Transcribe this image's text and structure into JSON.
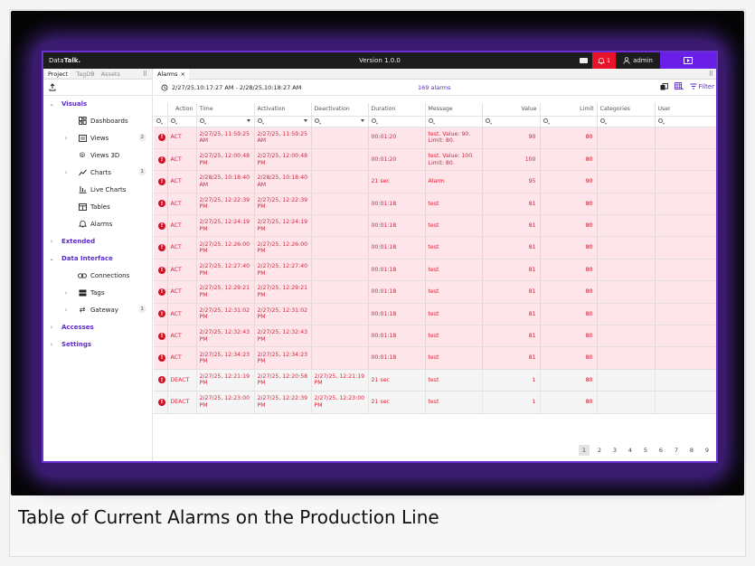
{
  "app": {
    "logo_prefix": "Data",
    "logo_bold": "Talk.",
    "version": "Version 1.0.0",
    "alarm_count": "1",
    "user": "admin"
  },
  "colors": {
    "accent": "#5b2ad0",
    "alarm_red": "#e8132a",
    "active_row": "#fde5ea",
    "titlebar": "#1d1d1d"
  },
  "left_tabs": [
    "Project",
    "TagDB",
    "Assets"
  ],
  "nav": {
    "visuals": "Visuals",
    "dashboards": "Dashboards",
    "views": "Views",
    "views_count": "2",
    "views3d": "Views 3D",
    "charts": "Charts",
    "charts_count": "1",
    "livecharts": "Live Charts",
    "tables": "Tables",
    "alarms": "Alarms",
    "extended": "Extended",
    "datainterface": "Data Interface",
    "connections": "Connections",
    "tags": "Tags",
    "gateway": "Gateway",
    "gateway_count": "1",
    "accesses": "Accesses",
    "settings": "Settings"
  },
  "main_tab": {
    "label": "Alarms",
    "close": "×"
  },
  "toolbar": {
    "range": "2/27/25,10:17:27 AM - 2/28/25,10:18:27 AM",
    "count": "169 alarms",
    "filter": "Filter"
  },
  "columns": [
    "Action",
    "Time",
    "Activation",
    "Deactivation",
    "Duration",
    "Message",
    "Value",
    "Limit",
    "Categories",
    "User"
  ],
  "rows": [
    {
      "action": "ACT",
      "time": "2/27/25, 11:59:25 AM",
      "activation": "2/27/25, 11:59:25 AM",
      "deactivation": "",
      "duration": "00:01:20",
      "message": "test. Value: 90. Limit: 80.",
      "value": "90",
      "limit": "80"
    },
    {
      "action": "ACT",
      "time": "2/27/25, 12:00:48 PM",
      "activation": "2/27/25, 12:00:48 PM",
      "deactivation": "",
      "duration": "00:01:20",
      "message": "test. Value: 100. Limit: 80.",
      "value": "100",
      "limit": "80"
    },
    {
      "action": "ACT",
      "time": "2/28/25, 10:18:40 AM",
      "activation": "2/28/25, 10:18:40 AM",
      "deactivation": "",
      "duration": "21 sec",
      "message": "Alarm",
      "value": "95",
      "limit": "90"
    },
    {
      "action": "ACT",
      "time": "2/27/25, 12:22:39 PM",
      "activation": "2/27/25, 12:22:39 PM",
      "deactivation": "",
      "duration": "00:01:18",
      "message": "test",
      "value": "81",
      "limit": "80"
    },
    {
      "action": "ACT",
      "time": "2/27/25, 12:24:19 PM",
      "activation": "2/27/25, 12:24:19 PM",
      "deactivation": "",
      "duration": "00:01:18",
      "message": "test",
      "value": "81",
      "limit": "80"
    },
    {
      "action": "ACT",
      "time": "2/27/25, 12:26:00 PM",
      "activation": "2/27/25, 12:26:00 PM",
      "deactivation": "",
      "duration": "00:01:18",
      "message": "test",
      "value": "81",
      "limit": "80"
    },
    {
      "action": "ACT",
      "time": "2/27/25, 12:27:40 PM",
      "activation": "2/27/25, 12:27:40 PM",
      "deactivation": "",
      "duration": "00:01:18",
      "message": "test",
      "value": "81",
      "limit": "80"
    },
    {
      "action": "ACT",
      "time": "2/27/25, 12:29:21 PM",
      "activation": "2/27/25, 12:29:21 PM",
      "deactivation": "",
      "duration": "00:01:18",
      "message": "test",
      "value": "81",
      "limit": "80"
    },
    {
      "action": "ACT",
      "time": "2/27/25, 12:31:02 PM",
      "activation": "2/27/25, 12:31:02 PM",
      "deactivation": "",
      "duration": "00:01:18",
      "message": "test",
      "value": "81",
      "limit": "80"
    },
    {
      "action": "ACT",
      "time": "2/27/25, 12:32:43 PM",
      "activation": "2/27/25, 12:32:43 PM",
      "deactivation": "",
      "duration": "00:01:18",
      "message": "test",
      "value": "81",
      "limit": "80"
    },
    {
      "action": "ACT",
      "time": "2/27/25, 12:34:23 PM",
      "activation": "2/27/25, 12:34:23 PM",
      "deactivation": "",
      "duration": "00:01:18",
      "message": "test",
      "value": "81",
      "limit": "80"
    },
    {
      "action": "DEACT",
      "time": "2/27/25, 12:21:19 PM",
      "activation": "2/27/25, 12:20:58 PM",
      "deactivation": "2/27/25, 12:21:19 PM",
      "duration": "21 sec",
      "message": "test",
      "value": "1",
      "limit": "80"
    },
    {
      "action": "DEACT",
      "time": "2/27/25, 12:23:00 PM",
      "activation": "2/27/25, 12:22:39 PM",
      "deactivation": "2/27/25, 12:23:00 PM",
      "duration": "21 sec",
      "message": "test",
      "value": "1",
      "limit": "80"
    }
  ],
  "pagination": {
    "pages": [
      "1",
      "2",
      "3",
      "4",
      "5",
      "6",
      "7",
      "8",
      "9"
    ],
    "current": "1"
  },
  "caption": "Table of Current Alarms on the Production Line"
}
